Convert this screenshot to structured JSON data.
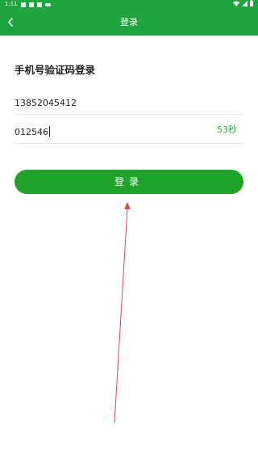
{
  "status_bar": {
    "time": "1:11",
    "icons": [
      "image-icon",
      "download-icon",
      "notification-icon",
      "cloud-icon"
    ],
    "right_icons": [
      "wifi-icon",
      "signal-icon",
      "battery-icon"
    ]
  },
  "app_bar": {
    "title": "登录",
    "background": "#1fa540"
  },
  "heading": "手机号验证码登录",
  "phone_field": {
    "value": "13852045412"
  },
  "code_field": {
    "value": "012546",
    "countdown": "53秒",
    "countdown_color": "#2da84b"
  },
  "login_button": {
    "label": "登录",
    "background": "#1fa328"
  },
  "annotation": {
    "color": "#e04848"
  }
}
